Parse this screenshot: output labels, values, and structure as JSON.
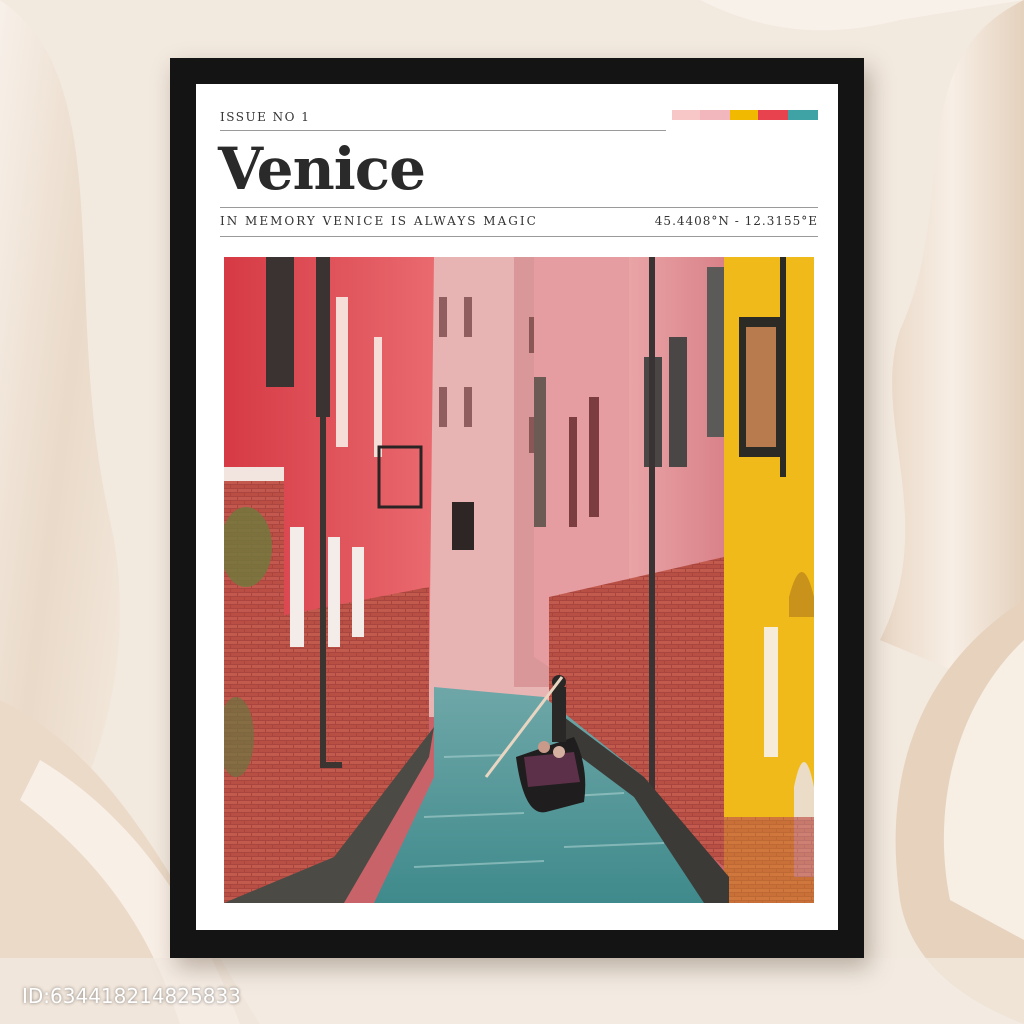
{
  "poster": {
    "issue": "ISSUE NO 1",
    "title": "Venice",
    "tagline": "IN MEMORY VENICE IS ALWAYS MAGIC",
    "coordinates": "45.4408°N - 12.3155°E",
    "swatch_colors": [
      "#f7c6c7",
      "#f2b6bd",
      "#f1b900",
      "#e8424f",
      "#3fa3a6"
    ]
  },
  "photo": {
    "subject": "gondola"
  },
  "watermark": {
    "id_text": "ID:634418214825833"
  },
  "colors": {
    "frame": "#141414",
    "mat": "#ffffff",
    "wall_red": "#d9484f",
    "wall_pink": "#e79aa0",
    "wall_yellow": "#edb91c",
    "water": "#4f9d9e"
  }
}
